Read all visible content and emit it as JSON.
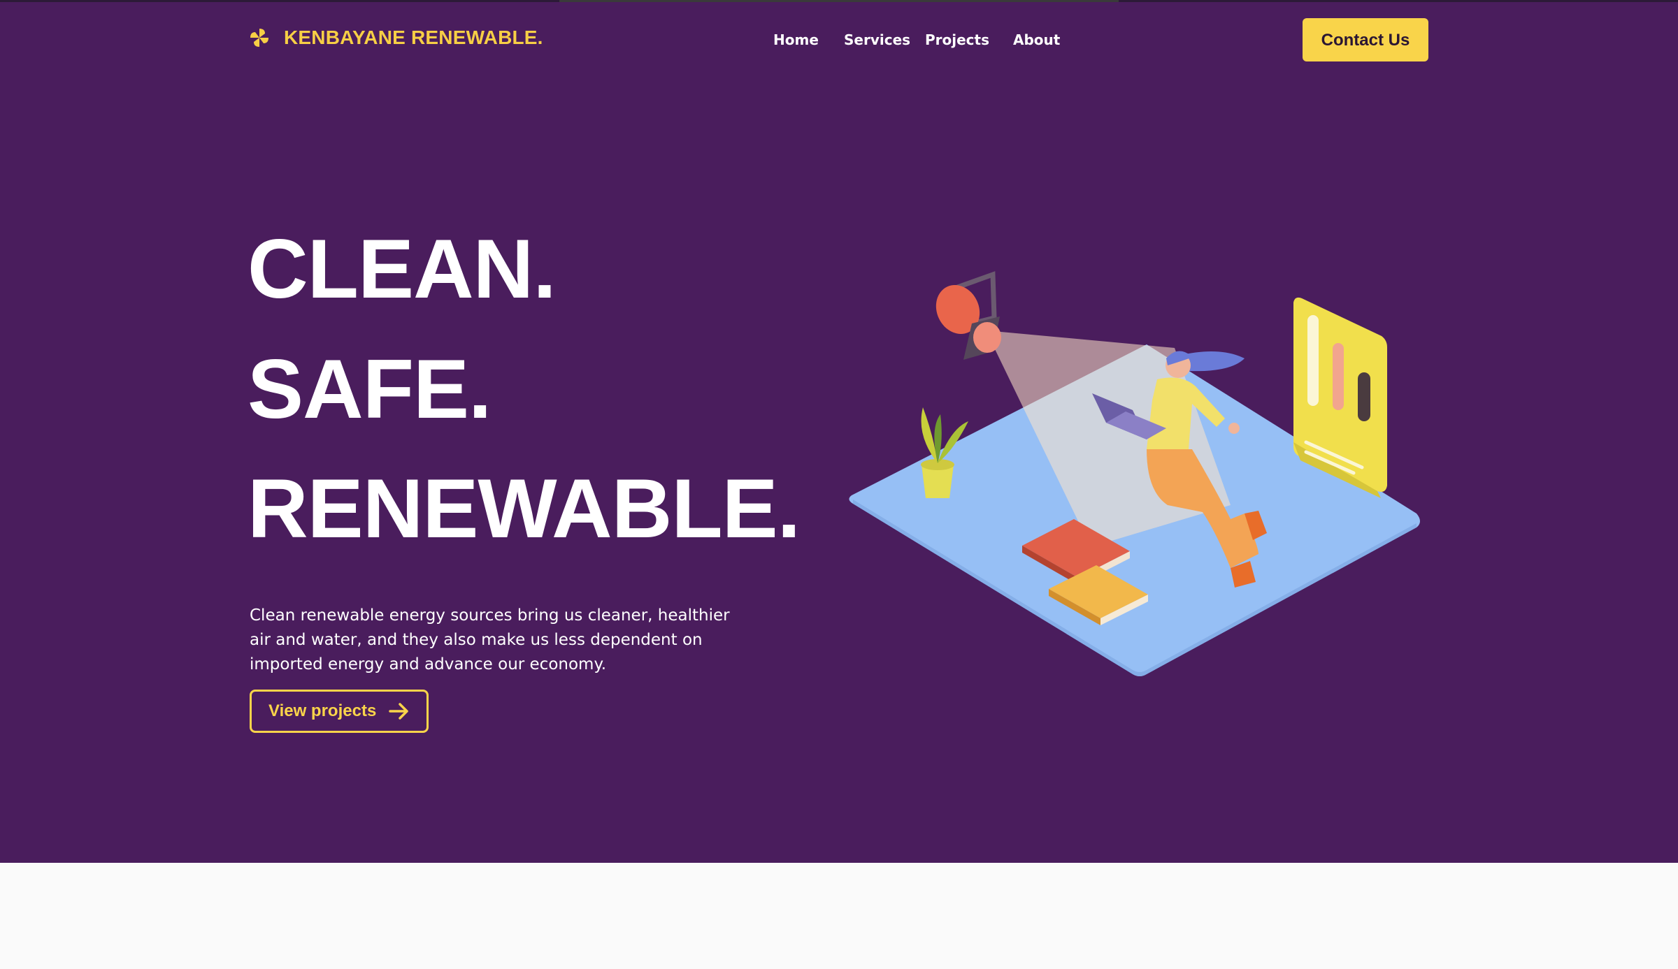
{
  "colors": {
    "hero_bg": "#4a1d5d",
    "accent_yellow": "#f9d44a",
    "text_white": "#ffffff",
    "button_text": "#2a1633",
    "page_bg": "#fafafa"
  },
  "header": {
    "brand": {
      "icon": "spinner-pinwheel-icon",
      "name": "KENBAYANE RENEWABLE."
    },
    "nav": [
      {
        "label": "Home"
      },
      {
        "label": "Services"
      },
      {
        "label": "Projects"
      },
      {
        "label": "About"
      }
    ],
    "cta_label": "Contact Us"
  },
  "hero": {
    "headline_lines": [
      "CLEAN.",
      "SAFE.",
      "RENEWABLE."
    ],
    "description": "Clean renewable energy sources bring us cleaner, healthier air and water, and they also make us less dependent on imported energy and advance our economy.",
    "button": {
      "label": "View projects",
      "icon": "arrow-right-icon"
    },
    "illustration": {
      "icon": "isometric-illustration-woman-laptop-projector"
    }
  }
}
